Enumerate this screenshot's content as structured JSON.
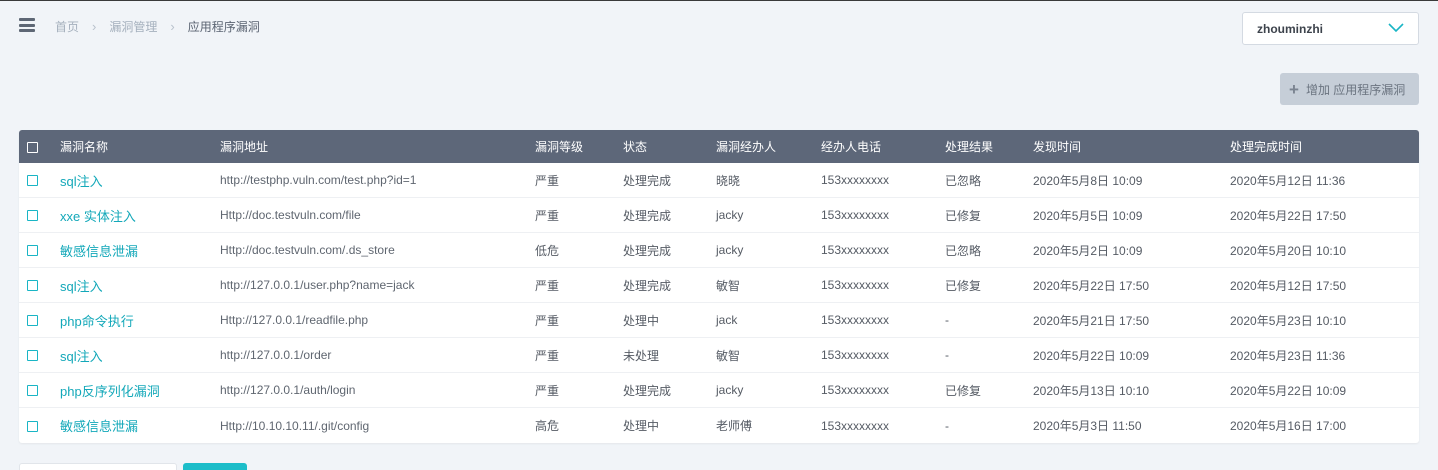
{
  "breadcrumb": {
    "home": "首页",
    "section": "漏洞管理",
    "current": "应用程序漏洞"
  },
  "user": {
    "name": "zhouminzhi"
  },
  "actions": {
    "add_label": "增加 应用程序漏洞"
  },
  "table": {
    "headers": [
      "漏洞名称",
      "漏洞地址",
      "漏洞等级",
      "状态",
      "漏洞经办人",
      "经办人电话",
      "处理结果",
      "发现时间",
      "处理完成时间"
    ],
    "rows": [
      [
        "sql注入",
        "http://testphp.vuln.com/test.php?id=1",
        "严重",
        "处理完成",
        "晓晓",
        "153xxxxxxxx",
        "已忽略",
        "2020年5月8日 10:09",
        "2020年5月12日 11:36"
      ],
      [
        "xxe 实体注入",
        "Http://doc.testvuln.com/file",
        "严重",
        "处理完成",
        "jacky",
        "153xxxxxxxx",
        "已修复",
        "2020年5月5日 10:09",
        "2020年5月22日 17:50"
      ],
      [
        "敏感信息泄漏",
        "Http://doc.testvuln.com/.ds_store",
        "低危",
        "处理完成",
        "jacky",
        "153xxxxxxxx",
        "已忽略",
        "2020年5月2日 10:09",
        "2020年5月20日 10:10"
      ],
      [
        "sql注入",
        "http://127.0.0.1/user.php?name=jack",
        "严重",
        "处理完成",
        "敏智",
        "153xxxxxxxx",
        "已修复",
        "2020年5月22日 17:50",
        "2020年5月12日 17:50"
      ],
      [
        "php命令执行",
        "Http://127.0.0.1/readfile.php",
        "严重",
        "处理中",
        "jack",
        "153xxxxxxxx",
        "-",
        "2020年5月21日 17:50",
        "2020年5月23日 10:10"
      ],
      [
        "sql注入",
        "http://127.0.0.1/order",
        "严重",
        "未处理",
        "敏智",
        "153xxxxxxxx",
        "-",
        "2020年5月22日 10:09",
        "2020年5月23日 11:36"
      ],
      [
        "php反序列化漏洞",
        "http://127.0.0.1/auth/login",
        "严重",
        "处理完成",
        "jacky",
        "153xxxxxxxx",
        "已修复",
        "2020年5月13日 10:10",
        "2020年5月22日 10:09"
      ],
      [
        "敏感信息泄漏",
        "Http://10.10.10.11/.git/config",
        "高危",
        "处理中",
        "老师傅",
        "153xxxxxxxx",
        "-",
        "2020年5月3日 11:50",
        "2020年5月16日 17:00"
      ]
    ]
  },
  "colors": {
    "header_bg": "#5d6779",
    "accent": "#13a8b9",
    "page_bg": "#f1f4f8"
  },
  "icons": {
    "menu": "hamburger-icon",
    "dropdown": "chevron-down-icon",
    "add": "plus-icon",
    "row_select": "checkbox-icon"
  }
}
